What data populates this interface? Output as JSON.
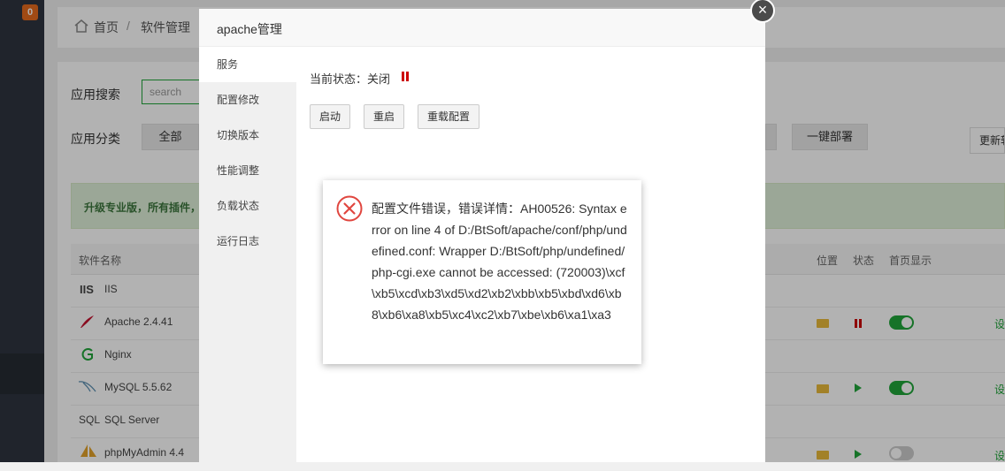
{
  "sidebar": {
    "badge_count": "0"
  },
  "breadcrumb": {
    "home": "首页",
    "separator": "/",
    "current": "软件管理"
  },
  "app_search": {
    "label": "应用搜索",
    "placeholder": "search"
  },
  "app_category": {
    "label": "应用分类",
    "all": "全部"
  },
  "toolbar": {
    "one_click_deploy": "一键部署",
    "update_partial": "更新软"
  },
  "notice": {
    "text": "升级专业版，所有插件，"
  },
  "table": {
    "headers": {
      "name": "软件名称",
      "location": "位置",
      "status": "状态",
      "home_display": "首页显示"
    },
    "rows": [
      {
        "icon": "iis-icon",
        "icon_text": "IIS",
        "name": "IIS"
      },
      {
        "icon": "apache-feather-icon",
        "name": "Apache 2.4.41",
        "has_folder": true,
        "status": "stopped",
        "home_display": true,
        "set": "设"
      },
      {
        "icon": "nginx-icon",
        "name": "Nginx"
      },
      {
        "icon": "mysql-dolphin-icon",
        "name": "MySQL 5.5.62",
        "has_folder": true,
        "status": "running",
        "home_display": true,
        "set": "设"
      },
      {
        "icon": "sqlserver-icon",
        "icon_text": "SQL",
        "name": "SQL Server"
      },
      {
        "icon": "phpmyadmin-sail-icon",
        "name": "phpMyAdmin 4.4",
        "has_folder": true,
        "status": "running",
        "home_display": false,
        "set": "设"
      }
    ]
  },
  "modal": {
    "title": "apache管理",
    "close_symbol": "×",
    "nav": [
      "服务",
      "配置修改",
      "切换版本",
      "性能调整",
      "负载状态",
      "运行日志"
    ],
    "status_label": "当前状态：关闭",
    "buttons": {
      "start": "启动",
      "restart": "重启",
      "reload": "重载配置"
    }
  },
  "error_dialog": {
    "message": "配置文件错误，错误详情：AH00526: Syntax error on line 4 of D:/BtSoft/apache/conf/php/undefined.conf: Wrapper D:/BtSoft/php/undefined/php-cgi.exe cannot be accessed: (720003)\\xcf\\xb5\\xcd\\xb3\\xd5\\xd2\\xb2\\xbb\\xb5\\xbd\\xd6\\xb8\\xb6\\xa8\\xb5\\xc4\\xc2\\xb7\\xbe\\xb6\\xa1\\xa3"
  },
  "colors": {
    "accent": "#20a53a",
    "danger": "#cc0000",
    "badge": "#e66b1e"
  }
}
